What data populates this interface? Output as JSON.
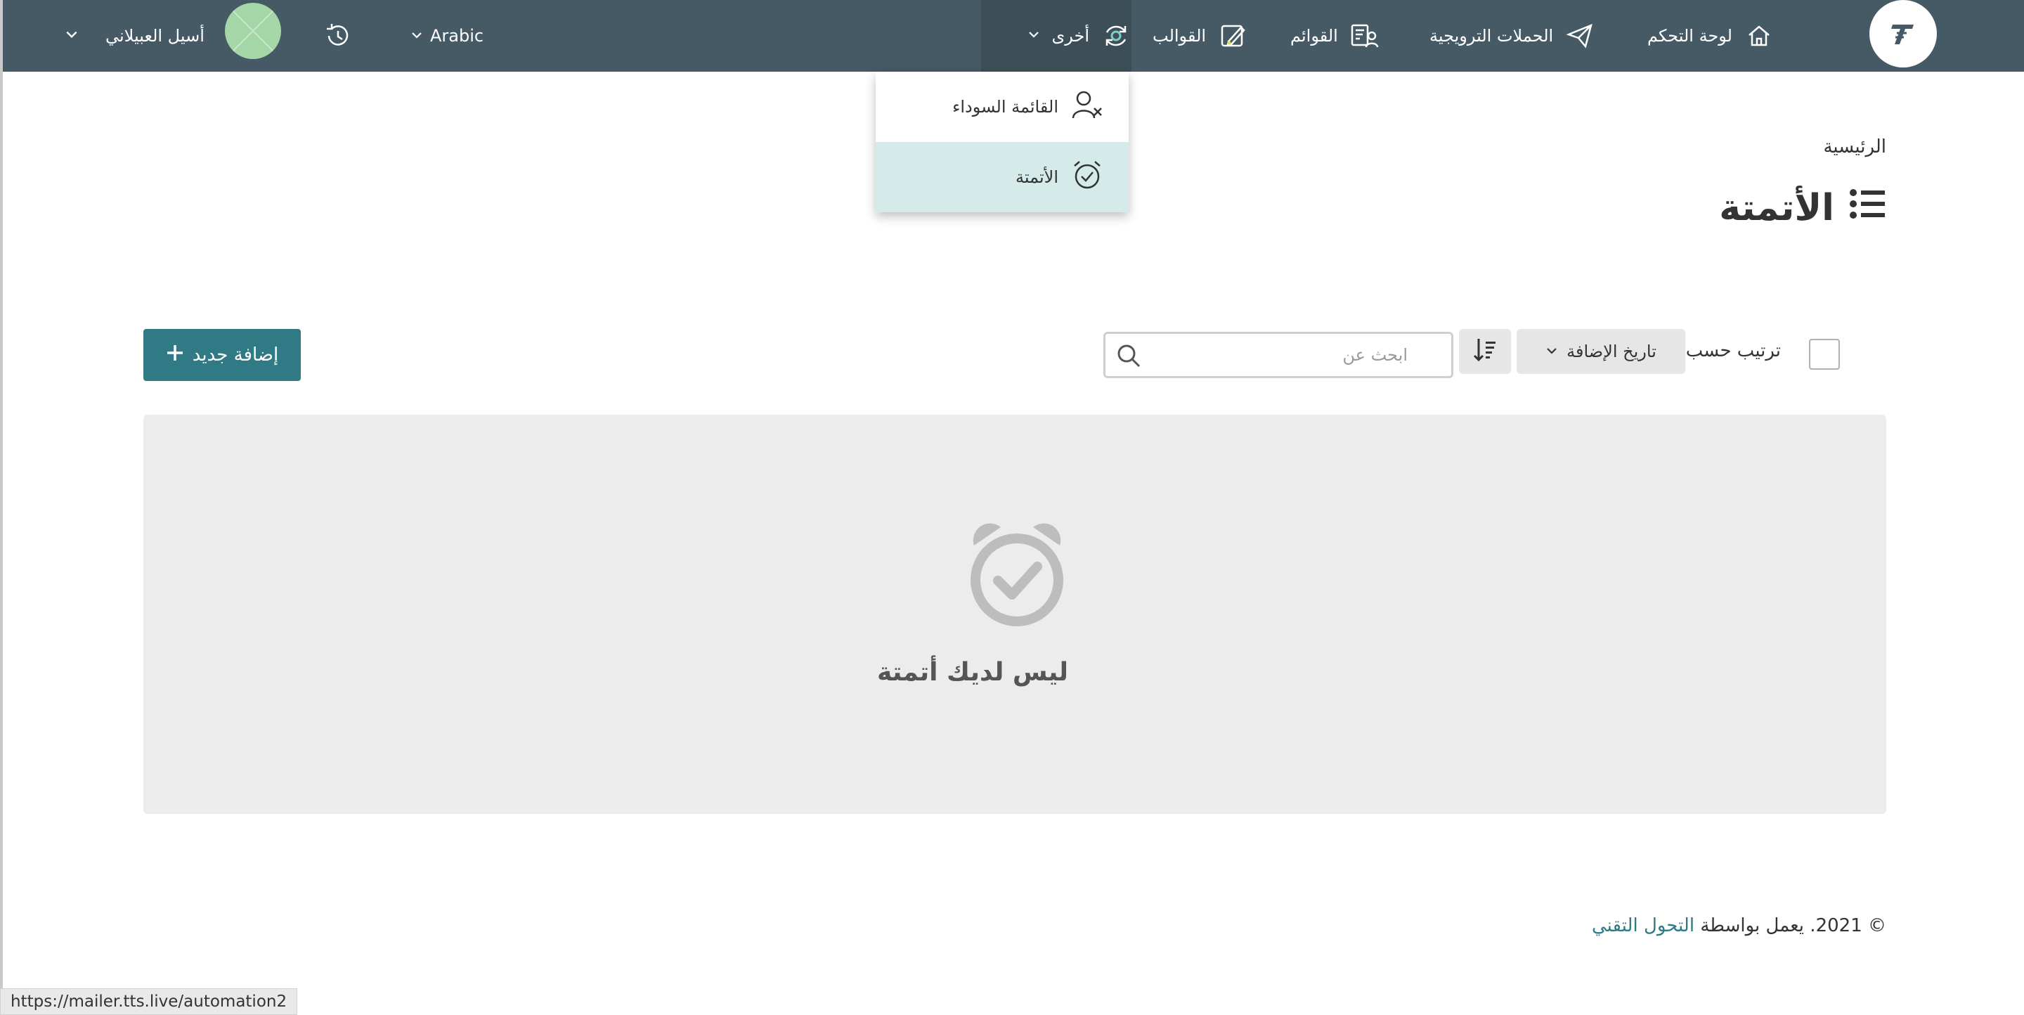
{
  "nav": {
    "dashboard": "لوحة التحكم",
    "campaigns": "الحملات الترويجية",
    "lists": "القوائم",
    "templates": "القوالب",
    "other": "أخرى",
    "language": "Arabic",
    "user_name": "أسيل العبيلاني"
  },
  "dropdown": {
    "blacklist": "القائمة السوداء",
    "automation": "الأتمتة"
  },
  "page": {
    "breadcrumb": "الرئيسية",
    "title": "الأتمتة"
  },
  "toolbar": {
    "sort_label": "ترتيب حسب",
    "sort_value": "تاريخ الإضافة",
    "search_placeholder": "ابحث عن",
    "add_new": "إضافة جديد"
  },
  "empty_state": {
    "message": "ليس لديك أتمتة"
  },
  "footer": {
    "prefix": "© 2021. يعمل بواسطة",
    "link": "التحول التقني"
  },
  "status_bar": {
    "url": "https://mailer.tts.live/automation2"
  },
  "colors": {
    "navbar": "#455a64",
    "accent": "#2f7a84",
    "selected_item": "#d5ebe9",
    "empty_bg": "#ececec"
  }
}
